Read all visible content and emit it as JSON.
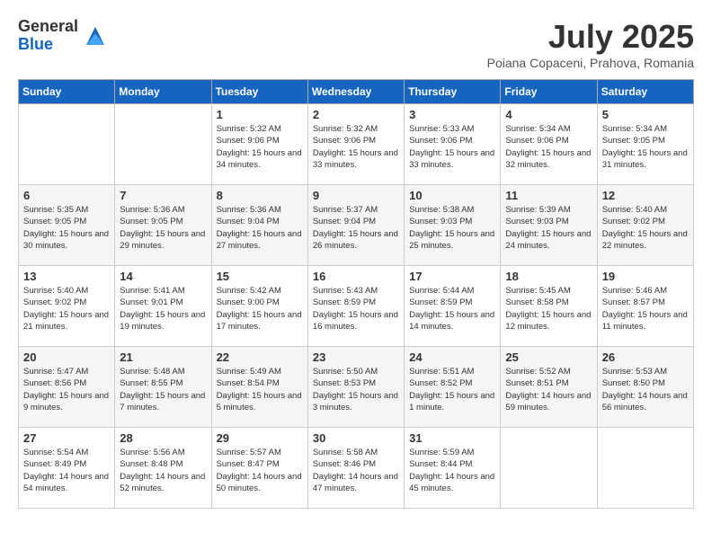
{
  "header": {
    "logo_general": "General",
    "logo_blue": "Blue",
    "month_title": "July 2025",
    "location": "Poiana Copaceni, Prahova, Romania"
  },
  "days_of_week": [
    "Sunday",
    "Monday",
    "Tuesday",
    "Wednesday",
    "Thursday",
    "Friday",
    "Saturday"
  ],
  "weeks": [
    [
      {
        "day": "",
        "info": ""
      },
      {
        "day": "",
        "info": ""
      },
      {
        "day": "1",
        "info": "Sunrise: 5:32 AM\nSunset: 9:06 PM\nDaylight: 15 hours and 34 minutes."
      },
      {
        "day": "2",
        "info": "Sunrise: 5:32 AM\nSunset: 9:06 PM\nDaylight: 15 hours and 33 minutes."
      },
      {
        "day": "3",
        "info": "Sunrise: 5:33 AM\nSunset: 9:06 PM\nDaylight: 15 hours and 33 minutes."
      },
      {
        "day": "4",
        "info": "Sunrise: 5:34 AM\nSunset: 9:06 PM\nDaylight: 15 hours and 32 minutes."
      },
      {
        "day": "5",
        "info": "Sunrise: 5:34 AM\nSunset: 9:05 PM\nDaylight: 15 hours and 31 minutes."
      }
    ],
    [
      {
        "day": "6",
        "info": "Sunrise: 5:35 AM\nSunset: 9:05 PM\nDaylight: 15 hours and 30 minutes."
      },
      {
        "day": "7",
        "info": "Sunrise: 5:36 AM\nSunset: 9:05 PM\nDaylight: 15 hours and 29 minutes."
      },
      {
        "day": "8",
        "info": "Sunrise: 5:36 AM\nSunset: 9:04 PM\nDaylight: 15 hours and 27 minutes."
      },
      {
        "day": "9",
        "info": "Sunrise: 5:37 AM\nSunset: 9:04 PM\nDaylight: 15 hours and 26 minutes."
      },
      {
        "day": "10",
        "info": "Sunrise: 5:38 AM\nSunset: 9:03 PM\nDaylight: 15 hours and 25 minutes."
      },
      {
        "day": "11",
        "info": "Sunrise: 5:39 AM\nSunset: 9:03 PM\nDaylight: 15 hours and 24 minutes."
      },
      {
        "day": "12",
        "info": "Sunrise: 5:40 AM\nSunset: 9:02 PM\nDaylight: 15 hours and 22 minutes."
      }
    ],
    [
      {
        "day": "13",
        "info": "Sunrise: 5:40 AM\nSunset: 9:02 PM\nDaylight: 15 hours and 21 minutes."
      },
      {
        "day": "14",
        "info": "Sunrise: 5:41 AM\nSunset: 9:01 PM\nDaylight: 15 hours and 19 minutes."
      },
      {
        "day": "15",
        "info": "Sunrise: 5:42 AM\nSunset: 9:00 PM\nDaylight: 15 hours and 17 minutes."
      },
      {
        "day": "16",
        "info": "Sunrise: 5:43 AM\nSunset: 8:59 PM\nDaylight: 15 hours and 16 minutes."
      },
      {
        "day": "17",
        "info": "Sunrise: 5:44 AM\nSunset: 8:59 PM\nDaylight: 15 hours and 14 minutes."
      },
      {
        "day": "18",
        "info": "Sunrise: 5:45 AM\nSunset: 8:58 PM\nDaylight: 15 hours and 12 minutes."
      },
      {
        "day": "19",
        "info": "Sunrise: 5:46 AM\nSunset: 8:57 PM\nDaylight: 15 hours and 11 minutes."
      }
    ],
    [
      {
        "day": "20",
        "info": "Sunrise: 5:47 AM\nSunset: 8:56 PM\nDaylight: 15 hours and 9 minutes."
      },
      {
        "day": "21",
        "info": "Sunrise: 5:48 AM\nSunset: 8:55 PM\nDaylight: 15 hours and 7 minutes."
      },
      {
        "day": "22",
        "info": "Sunrise: 5:49 AM\nSunset: 8:54 PM\nDaylight: 15 hours and 5 minutes."
      },
      {
        "day": "23",
        "info": "Sunrise: 5:50 AM\nSunset: 8:53 PM\nDaylight: 15 hours and 3 minutes."
      },
      {
        "day": "24",
        "info": "Sunrise: 5:51 AM\nSunset: 8:52 PM\nDaylight: 15 hours and 1 minute."
      },
      {
        "day": "25",
        "info": "Sunrise: 5:52 AM\nSunset: 8:51 PM\nDaylight: 14 hours and 59 minutes."
      },
      {
        "day": "26",
        "info": "Sunrise: 5:53 AM\nSunset: 8:50 PM\nDaylight: 14 hours and 56 minutes."
      }
    ],
    [
      {
        "day": "27",
        "info": "Sunrise: 5:54 AM\nSunset: 8:49 PM\nDaylight: 14 hours and 54 minutes."
      },
      {
        "day": "28",
        "info": "Sunrise: 5:56 AM\nSunset: 8:48 PM\nDaylight: 14 hours and 52 minutes."
      },
      {
        "day": "29",
        "info": "Sunrise: 5:57 AM\nSunset: 8:47 PM\nDaylight: 14 hours and 50 minutes."
      },
      {
        "day": "30",
        "info": "Sunrise: 5:58 AM\nSunset: 8:46 PM\nDaylight: 14 hours and 47 minutes."
      },
      {
        "day": "31",
        "info": "Sunrise: 5:59 AM\nSunset: 8:44 PM\nDaylight: 14 hours and 45 minutes."
      },
      {
        "day": "",
        "info": ""
      },
      {
        "day": "",
        "info": ""
      }
    ]
  ]
}
